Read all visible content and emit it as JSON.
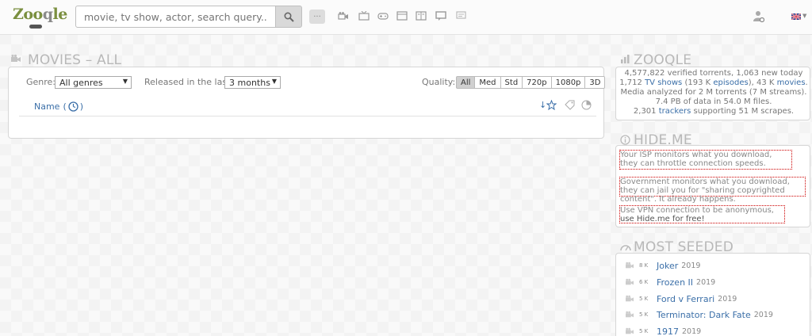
{
  "header": {
    "logo_text_a": "Zoo",
    "logo_text_b": "q",
    "logo_text_c": "le",
    "search_placeholder": "movie, tv show, actor, search query...",
    "more_label": "...",
    "category_icons": [
      "movie-icon",
      "tv-icon",
      "game-icon",
      "app-icon",
      "book-icon",
      "comment-icon",
      "forum-icon"
    ]
  },
  "main": {
    "title": "MOVIES – ALL",
    "genre_label": "Genre:",
    "genre_value": "All genres",
    "released_label": "Released in the last:",
    "released_value": "3 months",
    "quality_label": "Quality:",
    "quality_options": [
      "All",
      "Med",
      "Std",
      "720p",
      "1080p",
      "3D"
    ],
    "quality_selected": "All",
    "sort_name": "Name",
    "sort_paren_open": "(",
    "sort_paren_close": ")"
  },
  "sidebar": {
    "zooqle_title": "ZOOQLE",
    "stats": {
      "line1": "4,577,822 verified torrents, 1,063 new today",
      "line2_a": "1,712",
      "line2_link1": "TV shows",
      "line2_b": "(193 K",
      "line2_link2": "episodes",
      "line2_c": "), 43 K",
      "line2_link3": "movies",
      "line2_d": ".",
      "line3": "Media analyzed for 2 M torrents (7 M streams).",
      "line4": "7.4 PB of data in 54.0 M files.",
      "line5_a": "2,301",
      "line5_link": "trackers",
      "line5_b": "supporting 51 M scrapes."
    },
    "hideme_title": "HIDE.ME",
    "hideme_lines": [
      "Your ISP monitors what you download, they can throttle connection speeds.",
      "Government monitors what you download, they can jail you for \"sharing copyrighted content\". It already happens.",
      "Use VPN connection to be anonymous,"
    ],
    "hideme_link": "use Hide.me for free!",
    "most_seeded_title": "MOST SEEDED",
    "most_seeded": [
      {
        "count": "8 K",
        "title": "Joker",
        "year": "2019"
      },
      {
        "count": "6 K",
        "title": "Frozen II",
        "year": "2019"
      },
      {
        "count": "5 K",
        "title": "Ford v Ferrari",
        "year": "2019"
      },
      {
        "count": "5 K",
        "title": "Terminator: Dark Fate",
        "year": "2019"
      },
      {
        "count": "5 K",
        "title": "1917",
        "year": "2019"
      }
    ]
  },
  "colors": {
    "link": "#3b6fa8",
    "logo_green": "#7a8f3f",
    "highlight_border": "#cc0000"
  }
}
